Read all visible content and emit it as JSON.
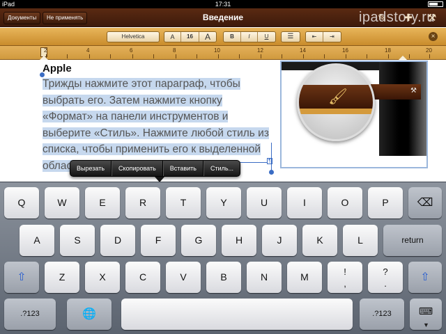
{
  "status_bar": {
    "carrier": "iPad",
    "time": "17:31"
  },
  "toolbar": {
    "documents_label": "Документы",
    "undo_label": "Не применять",
    "title": "Введение",
    "watermark": "ipadstory.ru",
    "icons": [
      "info-icon",
      "plus-icon",
      "wrench-icon"
    ]
  },
  "format_bar": {
    "font_name": "Helvetica",
    "font_smaller": "A",
    "font_size": "16",
    "font_larger": "A",
    "bold": "B",
    "italic": "I",
    "underline": "U",
    "close": "×"
  },
  "ruler": {
    "labels": [
      "2",
      "4",
      "6",
      "8",
      "10",
      "12",
      "14",
      "16",
      "18",
      "20"
    ]
  },
  "document": {
    "heading": "Apple",
    "paragraph": "Трижды нажмите этот параграф, чтобы выбрать его. Затем нажмите кнопку «Формат» на панели инструментов и выберите «Стиль». Нажмите любой стиль из списка, чтобы применить его к выделенной области."
  },
  "context_menu": {
    "items": [
      "Вырезать",
      "Скопировать",
      "Вставить",
      "Стиль..."
    ]
  },
  "keyboard": {
    "row1": [
      "Q",
      "W",
      "E",
      "R",
      "T",
      "Y",
      "U",
      "I",
      "O",
      "P"
    ],
    "row2": [
      "A",
      "S",
      "D",
      "F",
      "G",
      "H",
      "J",
      "K",
      "L"
    ],
    "row3": [
      "Z",
      "X",
      "C",
      "V",
      "B",
      "N",
      "M"
    ],
    "return_label": "return",
    "numbers_label": ".?123",
    "excl_top": "!",
    "excl_bottom": ",",
    "quest_top": "?",
    "quest_bottom": "."
  }
}
